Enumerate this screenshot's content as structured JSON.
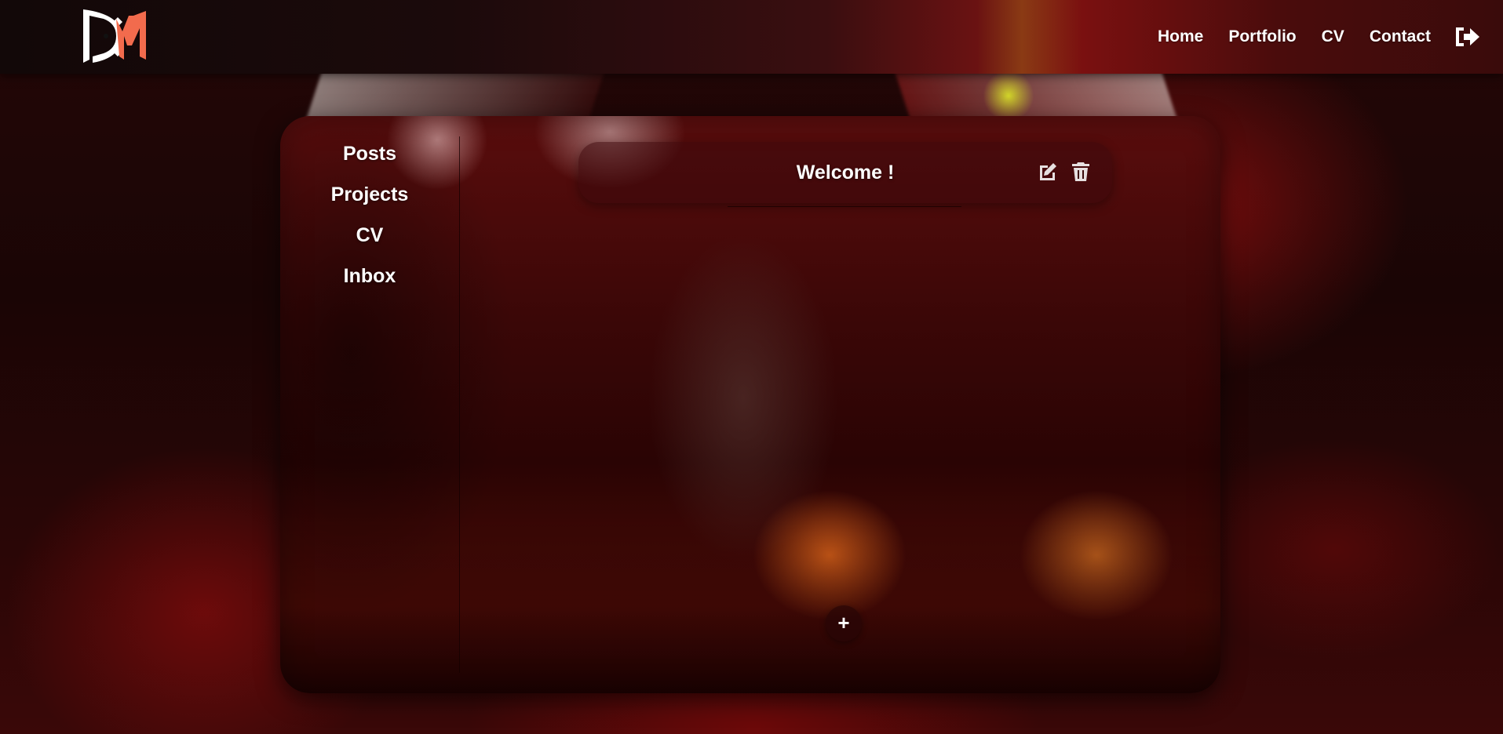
{
  "header": {
    "logo_alt": "DM",
    "nav": [
      {
        "label": "Home"
      },
      {
        "label": "Portfolio"
      },
      {
        "label": "CV"
      },
      {
        "label": "Contact"
      }
    ],
    "logout_icon": "sign-out-icon"
  },
  "sidebar": {
    "items": [
      {
        "label": "Posts"
      },
      {
        "label": "Projects"
      },
      {
        "label": "CV"
      },
      {
        "label": "Inbox"
      }
    ]
  },
  "posts": [
    {
      "title": "Welcome !",
      "edit_icon": "edit-icon",
      "delete_icon": "trash-icon"
    }
  ],
  "add_button": {
    "label": "+"
  },
  "colors": {
    "accent": "#f26b4d",
    "text": "#ffffff",
    "panel": "#3b0707"
  }
}
